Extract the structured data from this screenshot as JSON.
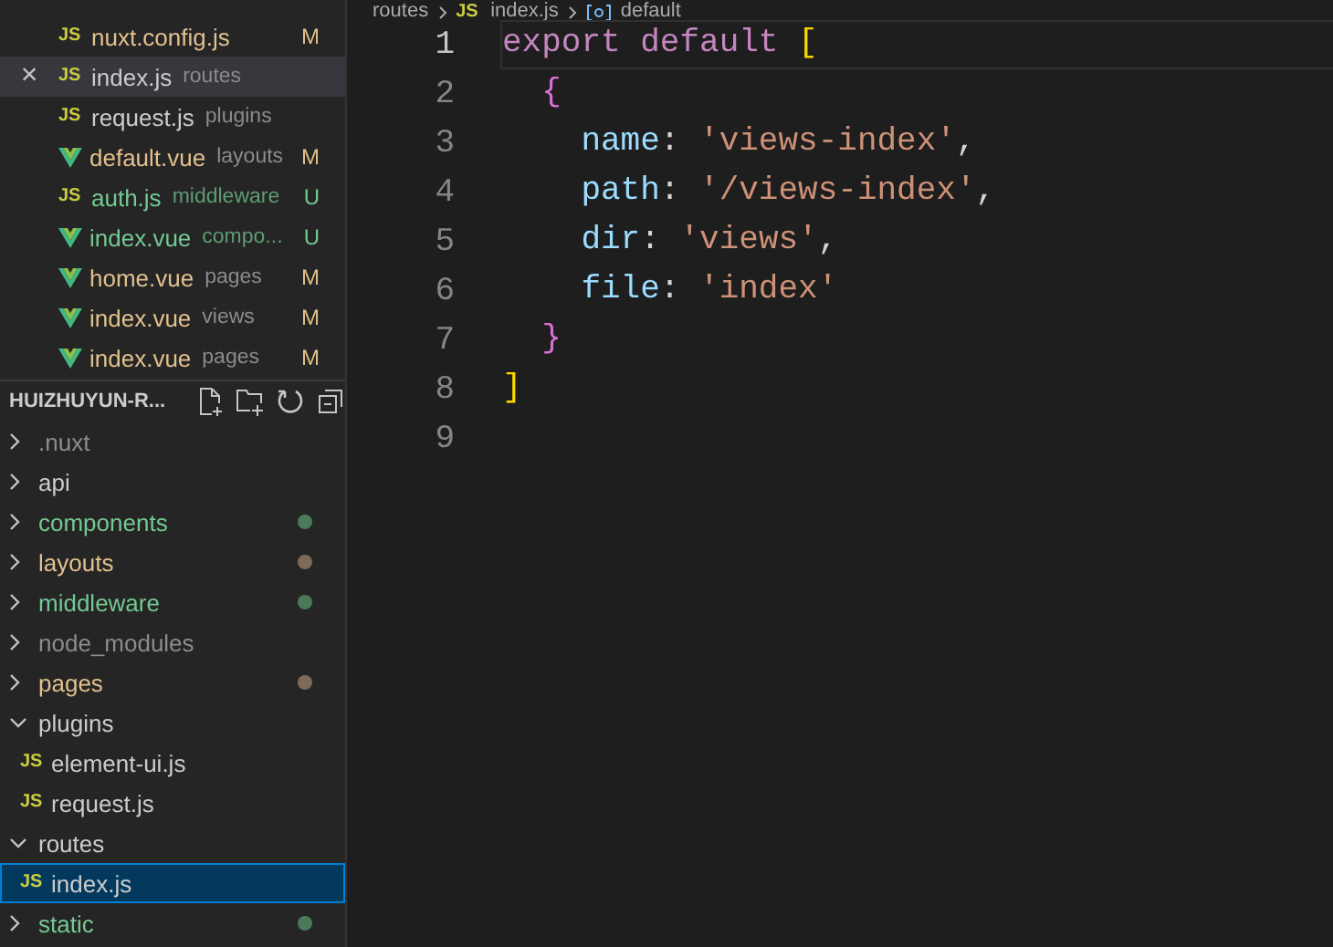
{
  "open_editors": [
    {
      "kind": "js",
      "badge": "JS",
      "name": "nuxt.config.js",
      "status": "M",
      "selected": false
    },
    {
      "kind": "js",
      "badge": "JS",
      "name": "index.js",
      "folder": "routes",
      "selected": true,
      "close": "×"
    },
    {
      "kind": "js",
      "badge": "JS",
      "name": "request.js",
      "folder": "plugins",
      "selected": false
    },
    {
      "kind": "vue",
      "name": "default.vue",
      "folder": "layouts",
      "status": "M",
      "selected": false
    },
    {
      "kind": "js",
      "badge": "JS",
      "name": "auth.js",
      "folder": "middleware",
      "status": "U",
      "selected": false
    },
    {
      "kind": "vue",
      "name": "index.vue",
      "folder": "compo...",
      "status": "U",
      "selected": false
    },
    {
      "kind": "vue",
      "name": "home.vue",
      "folder": "pages",
      "status": "M",
      "selected": false
    },
    {
      "kind": "vue",
      "name": "index.vue",
      "folder": "views",
      "status": "M",
      "selected": false
    },
    {
      "kind": "vue",
      "name": "index.vue",
      "folder": "pages",
      "status": "M",
      "selected": false
    }
  ],
  "explorer": {
    "title": "HUIZHUYUN-R...",
    "items": [
      {
        "name": ".nuxt",
        "kind": "folder",
        "expanded": false,
        "ignored": true,
        "selected": false
      },
      {
        "name": "api",
        "kind": "folder",
        "expanded": false,
        "selected": false
      },
      {
        "name": "components",
        "kind": "folder",
        "expanded": false,
        "untracked": true,
        "color": "#4b7a5a",
        "selected": false
      },
      {
        "name": "layouts",
        "kind": "folder",
        "expanded": false,
        "modified": true,
        "color": "#7d6b58",
        "selected": false
      },
      {
        "name": "middleware",
        "kind": "folder",
        "expanded": false,
        "untracked": true,
        "color": "#4b7a5a",
        "selected": false
      },
      {
        "name": "node_modules",
        "kind": "folder",
        "expanded": false,
        "ignored": true,
        "selected": false
      },
      {
        "name": "pages",
        "kind": "folder",
        "expanded": false,
        "modified": true,
        "color": "#7d6b58",
        "selected": false
      },
      {
        "name": "plugins",
        "kind": "folder",
        "expanded": true,
        "selected": false,
        "children": [
          {
            "name": "element-ui.js",
            "kind": "js",
            "badge": "JS",
            "selected": false
          },
          {
            "name": "request.js",
            "kind": "js",
            "badge": "JS",
            "selected": false
          }
        ]
      },
      {
        "name": "routes",
        "kind": "folder",
        "expanded": true,
        "selected": false,
        "children": [
          {
            "name": "index.js",
            "kind": "js",
            "badge": "JS",
            "selected": true
          }
        ]
      },
      {
        "name": "static",
        "kind": "folder",
        "expanded": false,
        "untracked": true,
        "color": "#4b7a5a",
        "selected": false
      }
    ]
  },
  "breadcrumb": [
    {
      "text": "routes",
      "kind": "folder"
    },
    {
      "text": "index.js",
      "kind": "js",
      "badge": "JS"
    },
    {
      "text": "default",
      "kind": "symbol"
    }
  ],
  "editor": {
    "lines": [
      {
        "number": "1",
        "active": true,
        "tokens": [
          {
            "t": "export default ",
            "kind": "keyword"
          },
          {
            "t": "[",
            "kind": "bracket1"
          }
        ]
      },
      {
        "number": "2",
        "active": false,
        "tokens": [
          {
            "t": "  {",
            "kind": "bracket2"
          }
        ]
      },
      {
        "number": "3",
        "active": false,
        "tokens": [
          {
            "t": "    name",
            "kind": "prop"
          },
          {
            "t": ": ",
            "kind": "plain"
          },
          {
            "t": "'views-index'",
            "kind": "string"
          },
          {
            "t": ",",
            "kind": "plain"
          }
        ]
      },
      {
        "number": "4",
        "active": false,
        "tokens": [
          {
            "t": "    path",
            "kind": "prop"
          },
          {
            "t": ": ",
            "kind": "plain"
          },
          {
            "t": "'/views-index'",
            "kind": "string"
          },
          {
            "t": ",",
            "kind": "plain"
          }
        ]
      },
      {
        "number": "5",
        "active": false,
        "tokens": [
          {
            "t": "    dir",
            "kind": "prop"
          },
          {
            "t": ": ",
            "kind": "plain"
          },
          {
            "t": "'views'",
            "kind": "string"
          },
          {
            "t": ",",
            "kind": "plain"
          }
        ]
      },
      {
        "number": "6",
        "active": false,
        "tokens": [
          {
            "t": "    file",
            "kind": "prop"
          },
          {
            "t": ": ",
            "kind": "plain"
          },
          {
            "t": "'index'",
            "kind": "string"
          }
        ]
      },
      {
        "number": "7",
        "active": false,
        "tokens": [
          {
            "t": "  }",
            "kind": "bracket2"
          }
        ]
      },
      {
        "number": "8",
        "active": false,
        "tokens": [
          {
            "t": "]",
            "kind": "bracket1"
          }
        ]
      },
      {
        "number": "9",
        "active": false
      }
    ]
  }
}
